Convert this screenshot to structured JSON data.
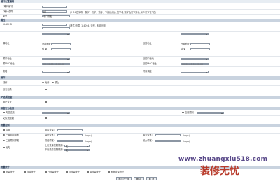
{
  "header": {
    "title": "端口配置编辑"
  },
  "basic": {
    "port_label": "*端口编号",
    "port_value": "",
    "name_label": "*端口名称",
    "name_value": "p0",
    "name_hint": "(1-64位字母、数字、汉字、减号、下划线组合,如字母,数字及汉字开头,每个汉字占2位)",
    "type_label": "类型",
    "type_value": "电口类型"
  },
  "attributes": {
    "section_title": "属性",
    "vlan_label": "VLAN ID",
    "vlan_hint": "(格式/范围: 1-4094, 逗号, 多组分隔)",
    "source_addr_label": "源地址",
    "dest_addr_label": "目的地址",
    "start_label": "开始地址",
    "end_label": "结 束",
    "source_port_label": "源口地址",
    "dest_port_label": "目的口地址",
    "source_mac_label": "源MAC地址",
    "dest_mac_label": "目的MAC地址",
    "mac_placeholder": "00-00-00-00-00-00",
    "mac2_placeholder": "00-00-00-00-00-00",
    "schedule_label": "策略",
    "time_label": "时间调度"
  },
  "action": {
    "section_title": "操作",
    "action_label": "动作",
    "allow": "允许",
    "deny": "禁止",
    "log_label": "日志记录"
  },
  "protocol": {
    "section_title": "IP选项检查",
    "user_label": "用户认证"
  },
  "behavior": {
    "section_title": "深度行为检测",
    "content_label": "内容过滤",
    "virus_label": "启用限制",
    "url_label": "文件夹限制"
  },
  "qos": {
    "section_title": "流量控制",
    "enable_label": "启用",
    "mode_label": "带口流量:",
    "bandwidth_label": "一级限制带宽",
    "bandwidth_sub": "保证带宽:",
    "unit": "(kbps)",
    "max_label": "最大带宽:",
    "bandwidth2_label": "二级限制带宽",
    "priority_label": "优先",
    "up_label": "上行流量控制规则:",
    "down_label": "下行流量控制规则:",
    "up_value": "无",
    "down_value": "无"
  },
  "stats": {
    "section_title": "流量统计",
    "items": [
      "流量统计",
      "连接统计",
      "日流量统计",
      "月流量统计",
      "周流量统计",
      "季度流量统计"
    ]
  },
  "buttons": {
    "add": "添加下一条",
    "ok": "确 定",
    "cancel": "取 消"
  },
  "watermark": {
    "url": "www.zhuangxiu518.com",
    "brand": "装修无忧"
  }
}
